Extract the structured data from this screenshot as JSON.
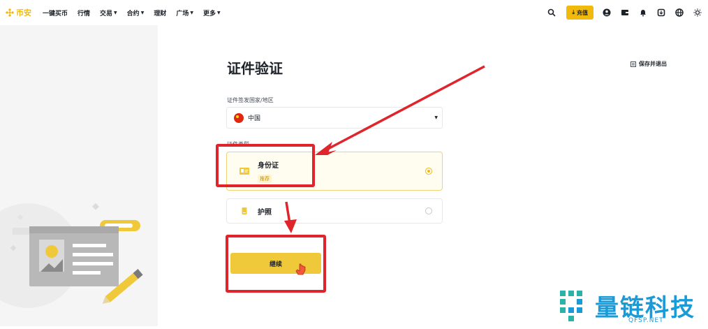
{
  "brand": {
    "name": "币安"
  },
  "nav": {
    "items": [
      {
        "label": "一键买币",
        "has_caret": false
      },
      {
        "label": "行情",
        "has_caret": false
      },
      {
        "label": "交易",
        "has_caret": true
      },
      {
        "label": "合约",
        "has_caret": true
      },
      {
        "label": "理财",
        "has_caret": false
      },
      {
        "label": "广场",
        "has_caret": true
      },
      {
        "label": "更多",
        "has_caret": true
      }
    ],
    "deposit_label": "充值",
    "icons": [
      "search-icon",
      "user-icon",
      "wallet-icon",
      "bell-icon",
      "download-icon",
      "globe-icon",
      "theme-icon"
    ]
  },
  "page": {
    "title": "证件验证",
    "save_exit_label": "保存并退出",
    "country_label": "证件签发国家/地区",
    "country_value": "中国",
    "doc_type_label": "证件类型",
    "options": [
      {
        "title": "身份证",
        "badge": "推荐",
        "selected": true
      },
      {
        "title": "护照",
        "badge": "",
        "selected": false
      }
    ],
    "continue_label": "继续"
  },
  "watermark": {
    "title": "量链科技",
    "subtitle": "QFSP.NET"
  },
  "colors": {
    "accent": "#f0b90b",
    "annotation": "#e0242c",
    "watermark": "#1a9ad6"
  }
}
